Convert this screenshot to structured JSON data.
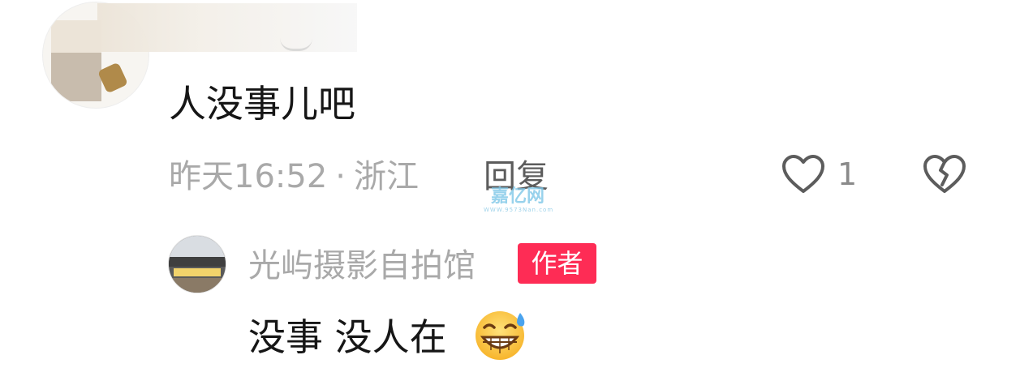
{
  "comment": {
    "text": "人没事儿吧",
    "time": "昨天16:52",
    "separator": "·",
    "location": "浙江",
    "reply_label": "回复",
    "like_count": "1",
    "icons": {
      "like": "heart-outline-icon",
      "dislike": "broken-heart-icon"
    }
  },
  "reply": {
    "username": "光屿摄影自拍馆",
    "badge": "作者",
    "badge_color": "#fe2c55",
    "text": "没事 没人在",
    "emoji": "grinning-sweat-emoji"
  },
  "watermark": {
    "main": "嘉亿网",
    "sub": "WWW.9573Nan.com"
  },
  "colors": {
    "primary_text": "#161616",
    "secondary_text": "#a9a9a9",
    "reply_label": "#5c5c5c",
    "background": "#ffffff"
  }
}
